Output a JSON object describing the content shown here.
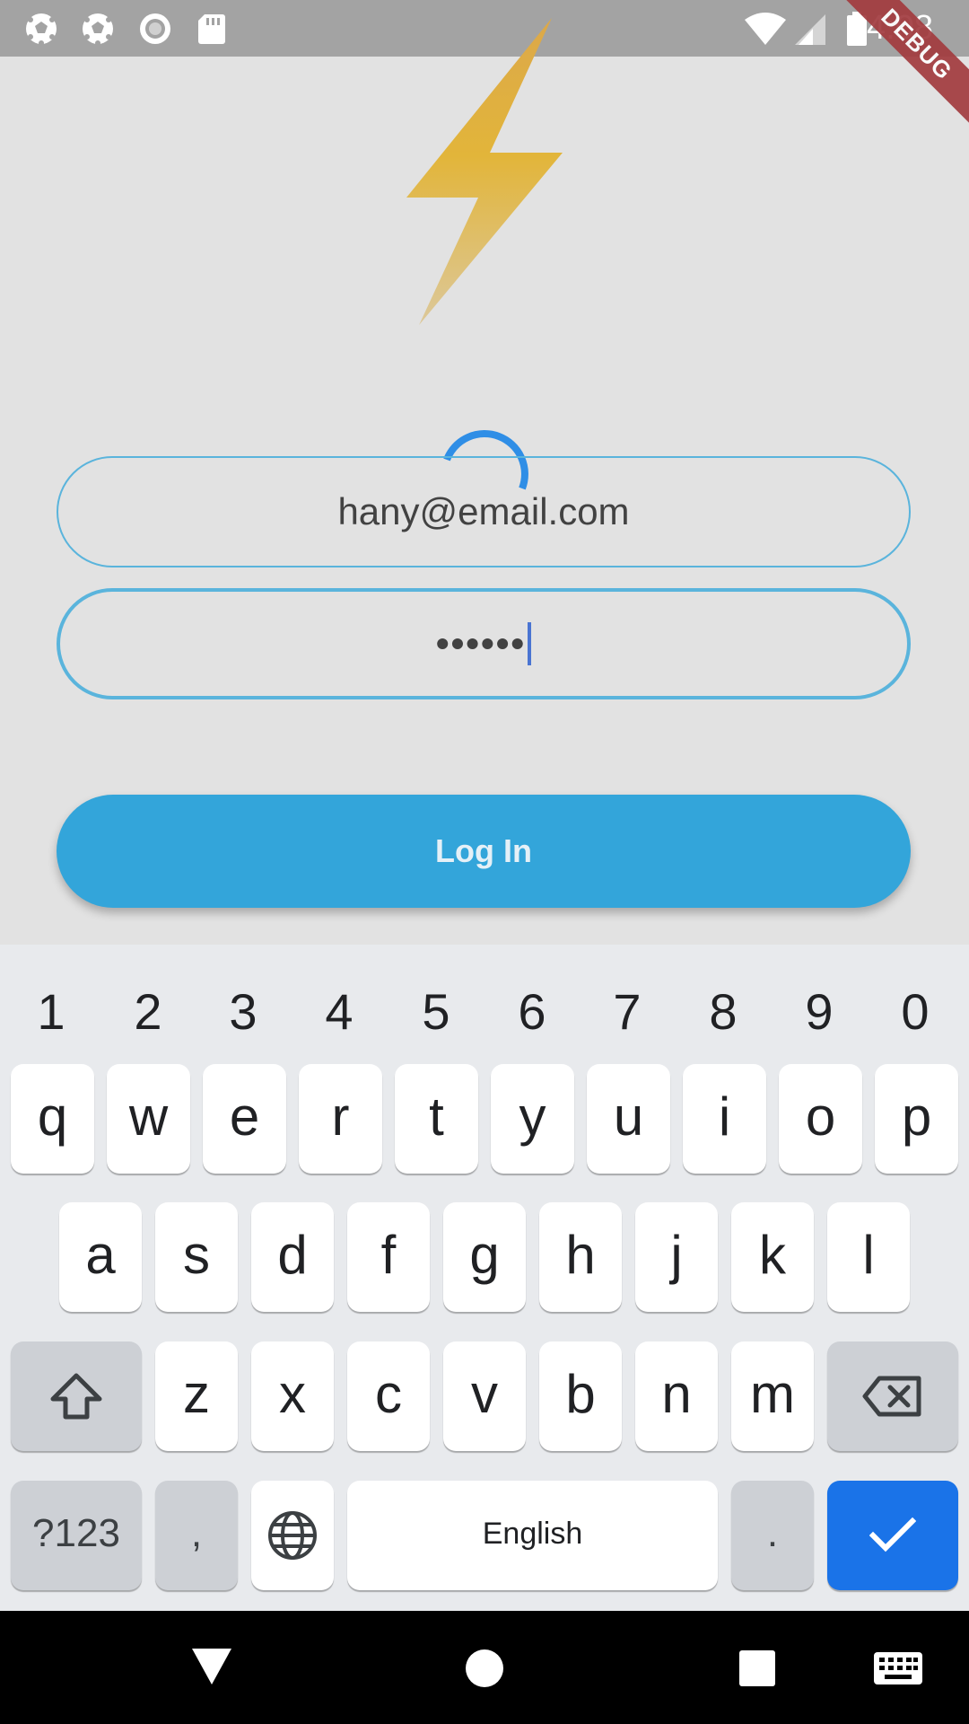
{
  "status_bar": {
    "time": "4:08",
    "debug_label": "DEBUG",
    "left_icons": [
      "soccer-ball-icon",
      "soccer-ball-icon",
      "circle-notification-icon",
      "sd-card-icon"
    ],
    "right_icons": [
      "wifi-icon",
      "cellular-signal-icon",
      "battery-icon"
    ]
  },
  "login": {
    "logo_icon": "lightning-bolt-icon",
    "logo_colors": [
      "#e2b53a",
      "#dcc48a"
    ],
    "email_value": "hany@email.com",
    "password_value": "••••••",
    "login_button_label": "Log In",
    "accent_color": "#33a5da",
    "loading": true
  },
  "keyboard": {
    "number_row": [
      "1",
      "2",
      "3",
      "4",
      "5",
      "6",
      "7",
      "8",
      "9",
      "0"
    ],
    "row1": [
      "q",
      "w",
      "e",
      "r",
      "t",
      "y",
      "u",
      "i",
      "o",
      "p"
    ],
    "row2": [
      "a",
      "s",
      "d",
      "f",
      "g",
      "h",
      "j",
      "k",
      "l"
    ],
    "row3": [
      "z",
      "x",
      "c",
      "v",
      "b",
      "n",
      "m"
    ],
    "symbols_label": "?123",
    "comma_label": ",",
    "space_label": "English",
    "period_label": ".",
    "shift_icon": "shift-icon",
    "backspace_icon": "backspace-icon",
    "language_icon": "globe-icon",
    "enter_icon": "checkmark-icon"
  },
  "nav_bar": {
    "icons": [
      "back-triangle-icon",
      "home-circle-icon",
      "recents-square-icon",
      "keyboard-icon"
    ]
  }
}
